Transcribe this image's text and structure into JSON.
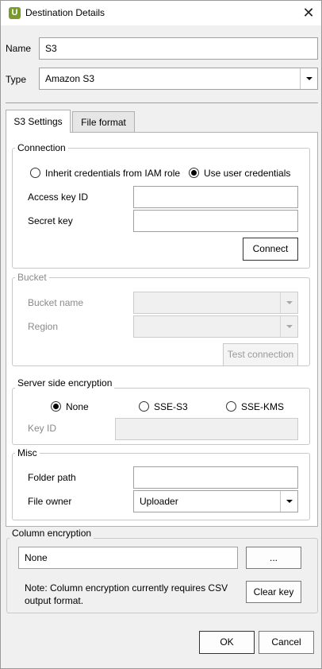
{
  "window": {
    "title": "Destination Details",
    "app_icon_letter": "U",
    "close_glyph": "✕"
  },
  "name": {
    "label": "Name",
    "value": "S3"
  },
  "type": {
    "label": "Type",
    "value": "Amazon S3"
  },
  "tabs": [
    {
      "label": "S3 Settings",
      "active": true
    },
    {
      "label": "File format",
      "active": false
    }
  ],
  "connection": {
    "title": "Connection",
    "radio_iam": {
      "label": "Inherit credentials from IAM role",
      "checked": false
    },
    "radio_user": {
      "label": "Use user credentials",
      "checked": true
    },
    "access_key_label": "Access key ID",
    "access_key_value": "",
    "secret_key_label": "Secret key",
    "secret_key_value": "",
    "connect_label": "Connect"
  },
  "bucket": {
    "title": "Bucket",
    "bucket_name_label": "Bucket name",
    "bucket_name_value": "",
    "region_label": "Region",
    "region_value": "",
    "test_connection_label": "Test connection"
  },
  "sse": {
    "title": "Server side encryption",
    "options": [
      {
        "label": "None",
        "checked": true
      },
      {
        "label": "SSE-S3",
        "checked": false
      },
      {
        "label": "SSE-KMS",
        "checked": false
      }
    ],
    "key_id_label": "Key ID",
    "key_id_value": ""
  },
  "misc": {
    "title": "Misc",
    "folder_path_label": "Folder path",
    "folder_path_value": "",
    "file_owner_label": "File owner",
    "file_owner_value": "Uploader"
  },
  "column_encryption": {
    "title": "Column encryption",
    "value": "None",
    "browse_label": "...",
    "note": "Note: Column encryption currently requires CSV output format.",
    "clear_key_label": "Clear key"
  },
  "footer": {
    "ok_label": "OK",
    "cancel_label": "Cancel"
  }
}
